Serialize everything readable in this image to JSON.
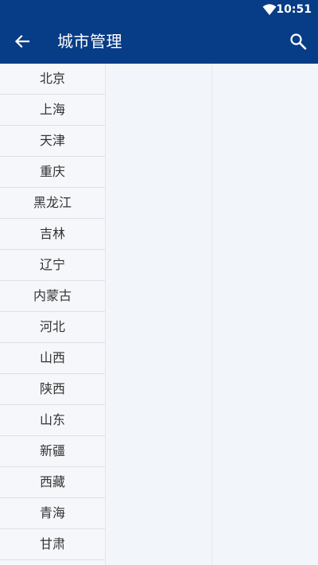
{
  "status_bar": {
    "time": "10:51",
    "icons": [
      "wifi-icon"
    ]
  },
  "app_bar": {
    "title": "城市管理",
    "back_icon": "arrow-left-icon",
    "search_icon": "search-icon"
  },
  "colors": {
    "primary": "#073c87",
    "background": "#f2f6fa",
    "divider": "#dde2e8",
    "text": "#333333"
  },
  "provinces": [
    "北京",
    "上海",
    "天津",
    "重庆",
    "黑龙江",
    "吉林",
    "辽宁",
    "内蒙古",
    "河北",
    "山西",
    "陕西",
    "山东",
    "新疆",
    "西藏",
    "青海",
    "甘肃"
  ]
}
